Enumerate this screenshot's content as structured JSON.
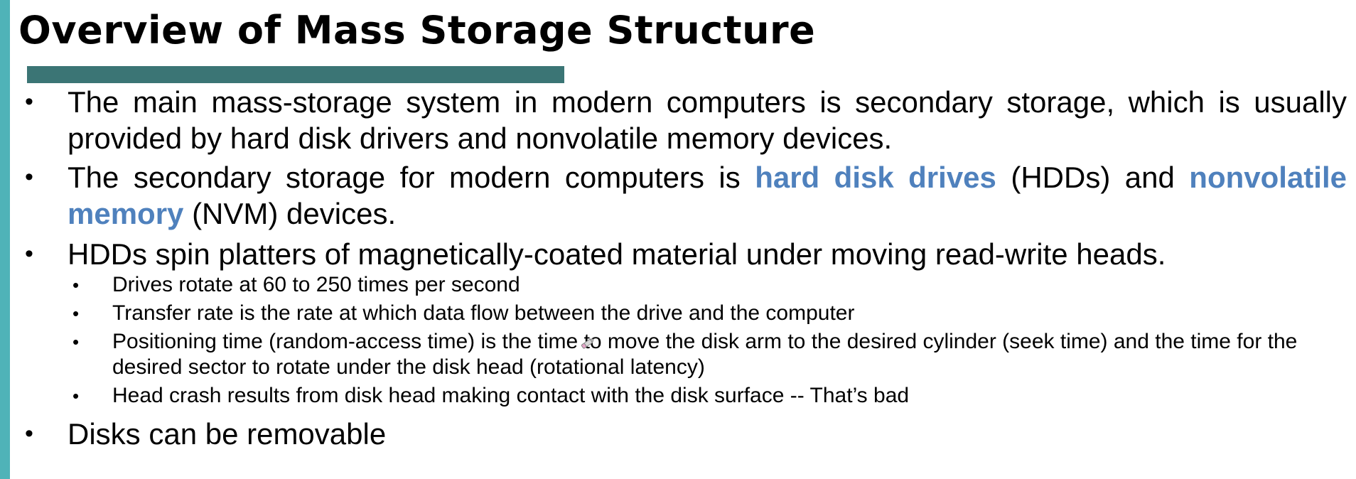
{
  "title": "Overview of Mass Storage Structure",
  "colors": {
    "accent_bar": "#4fb3b8",
    "underline": "#3b7575",
    "highlight": "#4f81bd"
  },
  "bullet_char": "•",
  "bullets": [
    {
      "text": "The main mass-storage system in modern computers is secondary storage, which is usually provided by hard disk drivers and nonvolatile memory devices."
    },
    {
      "part1": "The secondary storage for modern computers is ",
      "hl1": "hard disk drives",
      "part2": " (HDDs) and ",
      "hl2": "nonvolatile memory",
      "part3": " (NVM) devices."
    },
    {
      "text": "HDDs spin platters of magnetically-coated material under moving read-write heads.",
      "sub": [
        "Drives rotate at 60 to 250 times per second",
        "Transfer rate is the rate at which data flow between the drive and the computer",
        {
          "part1": "Positioning time (random-access time) is the time ",
          "part2": "to move the disk arm to the desired cylinder (seek time) and the time for the desired sector to rotate under the disk head  (rotational latency)"
        },
        "Head crash results from disk head making contact with the disk surface --  That’s bad"
      ]
    },
    {
      "text": "Disks can be removable"
    }
  ],
  "icons": {
    "annotation_pen": "pen-cursor-icon"
  }
}
